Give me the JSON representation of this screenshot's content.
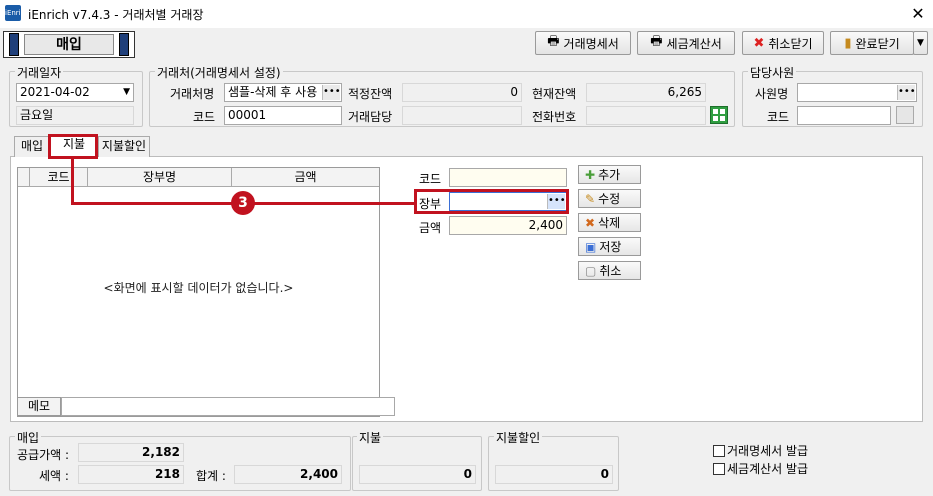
{
  "window": {
    "app_icon_text": "iEnrich",
    "title": "iEnrich v7.4.3 - 거래처별 거래장",
    "close_glyph": "✕"
  },
  "mode": {
    "label": "매입"
  },
  "toolbar": {
    "statement_btn": "거래명세서",
    "tax_invoice_btn": "세금계산서",
    "cancel_close_btn": "취소닫기",
    "done_close_btn": "완료닫기"
  },
  "header": {
    "trade_date_group": "거래일자",
    "trade_date": "2021-04-02",
    "weekday": "금요일",
    "client_group": "거래처(거래명세서 설정)",
    "client_name_label": "거래처명",
    "client_name": "샘플-삭제 후 사용",
    "code_label": "코드",
    "code_value": "00001",
    "opening_balance_label": "적정잔액",
    "opening_balance": "0",
    "client_contact_label": "거래담당",
    "client_contact": "",
    "current_balance_label": "현재잔액",
    "current_balance": "6,265",
    "phone_label": "전화번호",
    "phone": "",
    "staff_group": "담당사원",
    "staff_name_label": "사원명",
    "staff_name": "",
    "staff_code_label": "코드",
    "staff_code": ""
  },
  "tabs": [
    {
      "label": "매입"
    },
    {
      "label": "지불"
    },
    {
      "label": "지불할인"
    }
  ],
  "grid": {
    "columns": [
      "코드",
      "장부명",
      "금액"
    ],
    "empty_message": "<화면에 표시할 데이터가 없습니다.>"
  },
  "memo": {
    "label": "메모",
    "value": ""
  },
  "form": {
    "code_label": "코드",
    "code_value": "",
    "ledger_label": "장부",
    "ledger_value": "",
    "amount_label": "금액",
    "amount_value": "2,400"
  },
  "actions": {
    "add": "추가",
    "edit": "수정",
    "delete": "삭제",
    "save": "저장",
    "cancel": "취소"
  },
  "annotation": {
    "marker": "3"
  },
  "summary": {
    "purchase_group": "매입",
    "supply_label": "공급가액 :",
    "supply_value": "2,182",
    "tax_label": "세액 :",
    "tax_value": "218",
    "total_label": "합계 :",
    "total_value": "2,400",
    "payment_group": "지불",
    "payment_value": "0",
    "discount_group": "지불할인",
    "discount_value": "0"
  },
  "options": {
    "statement_issue": "거래명세서 발급",
    "tax_invoice_issue": "세금계산서 발급"
  },
  "colors": {
    "accent_red": "#c1121f",
    "mode_bar": "#1f3f7a"
  }
}
